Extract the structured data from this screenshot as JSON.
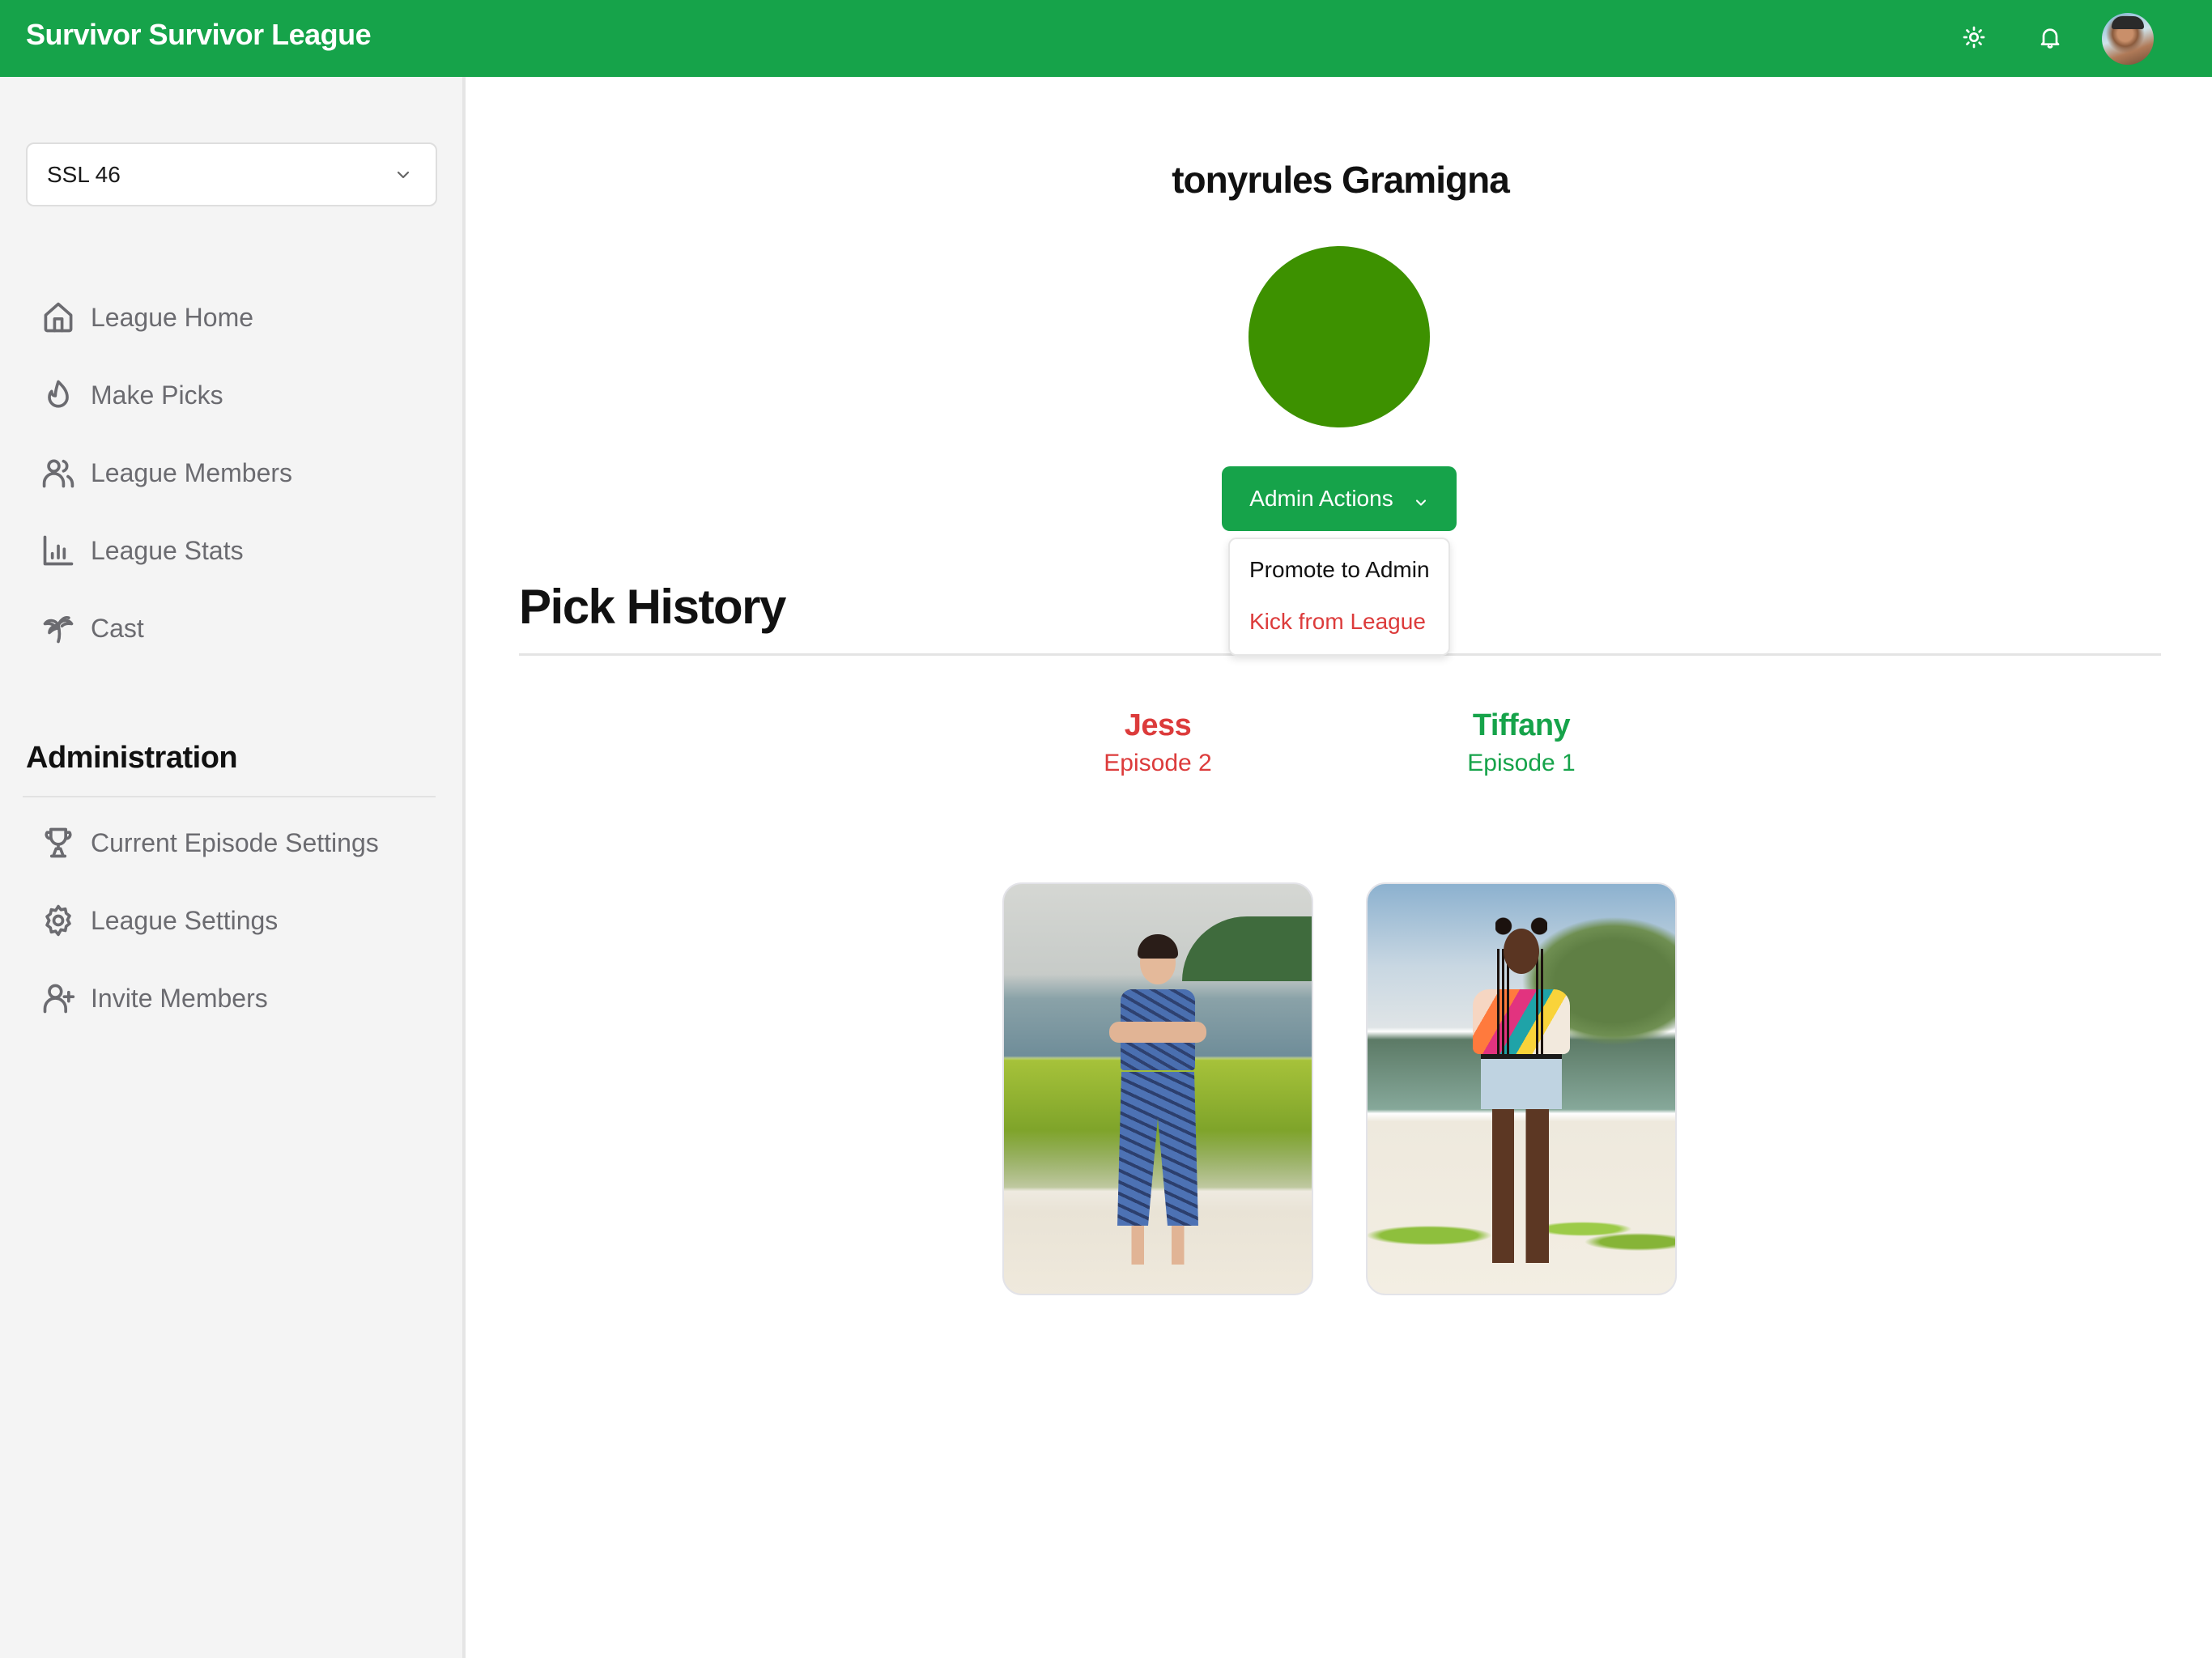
{
  "app": {
    "title": "Survivor Survivor League"
  },
  "topbar": {
    "icons": [
      "sun-icon",
      "bell-icon"
    ],
    "avatar_alt": "user avatar"
  },
  "sidebar": {
    "league_select": {
      "value": "SSL 46"
    },
    "nav_items": [
      {
        "label": "League Home",
        "icon": "home-icon"
      },
      {
        "label": "Make Picks",
        "icon": "flame-icon"
      },
      {
        "label": "League Members",
        "icon": "users-icon"
      },
      {
        "label": "League Stats",
        "icon": "bar-chart-icon"
      },
      {
        "label": "Cast",
        "icon": "palm-tree-icon"
      }
    ],
    "admin": {
      "heading": "Administration",
      "items": [
        {
          "label": "Current Episode Settings",
          "icon": "trophy-icon"
        },
        {
          "label": "League Settings",
          "icon": "gear-icon"
        },
        {
          "label": "Invite Members",
          "icon": "user-plus-icon"
        }
      ]
    }
  },
  "profile": {
    "name": "tonyrules Gramigna",
    "avatar_color": "#3d9100",
    "admin_actions": {
      "label": "Admin Actions",
      "menu": [
        {
          "label": "Promote to Admin",
          "tone": "default"
        },
        {
          "label": "Kick from League",
          "tone": "danger"
        }
      ]
    }
  },
  "pick_history": {
    "title": "Pick History",
    "picks": [
      {
        "name": "Jess",
        "episode": "Episode 2",
        "status": "eliminated",
        "color": "#dc3b3b"
      },
      {
        "name": "Tiffany",
        "episode": "Episode 1",
        "status": "safe",
        "color": "#16a34a"
      }
    ]
  },
  "colors": {
    "brand": "#16a34a",
    "danger": "#dc3b3b",
    "sidebar_bg": "#f4f4f4",
    "nav_text": "#6b6b70"
  }
}
